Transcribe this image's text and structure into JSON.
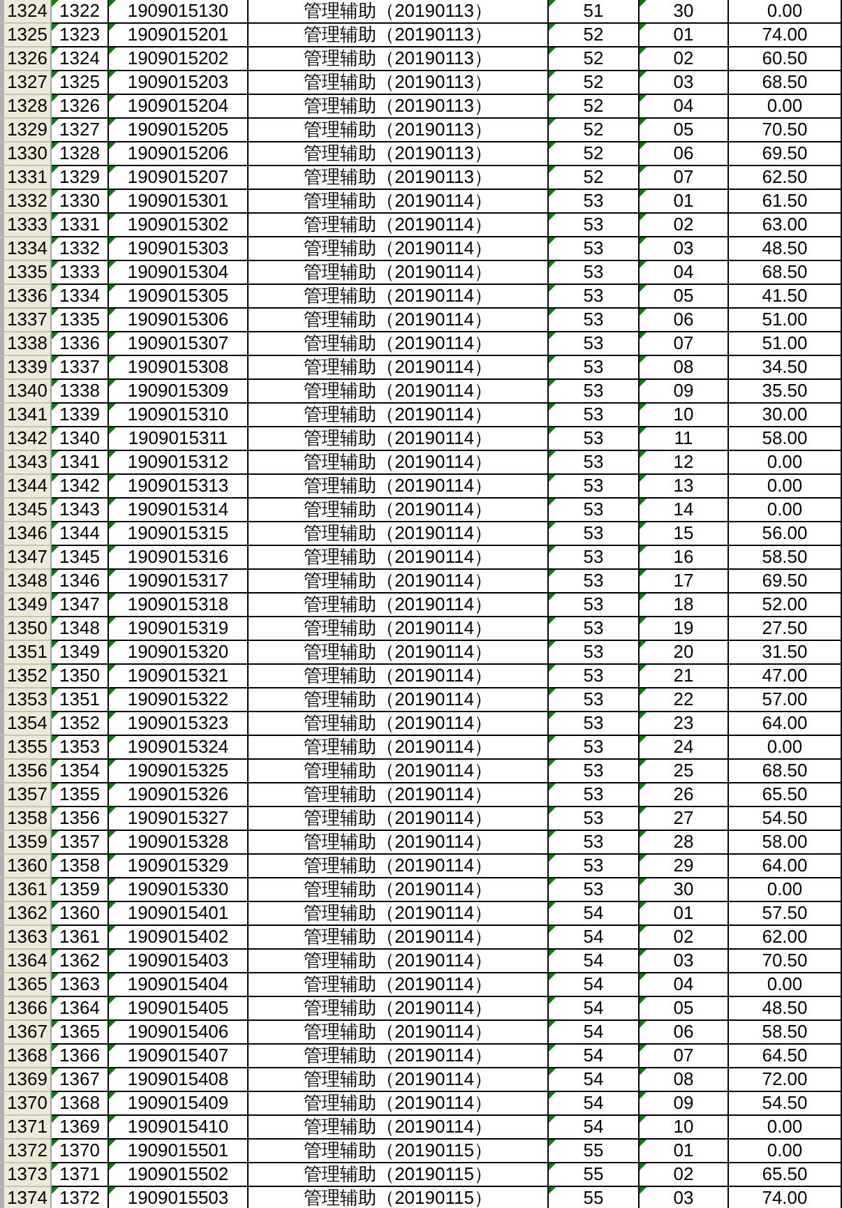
{
  "columns": [
    {
      "marker": true
    },
    {
      "marker": true
    },
    {
      "marker": false
    },
    {
      "marker": true
    },
    {
      "marker": true
    },
    {
      "marker": false
    }
  ],
  "rows": [
    {
      "header": "1324",
      "cells": [
        "1322",
        "1909015130",
        "管理辅助（20190113）",
        "51",
        "30",
        "0.00"
      ]
    },
    {
      "header": "1325",
      "cells": [
        "1323",
        "1909015201",
        "管理辅助（20190113）",
        "52",
        "01",
        "74.00"
      ]
    },
    {
      "header": "1326",
      "cells": [
        "1324",
        "1909015202",
        "管理辅助（20190113）",
        "52",
        "02",
        "60.50"
      ]
    },
    {
      "header": "1327",
      "cells": [
        "1325",
        "1909015203",
        "管理辅助（20190113）",
        "52",
        "03",
        "68.50"
      ]
    },
    {
      "header": "1328",
      "cells": [
        "1326",
        "1909015204",
        "管理辅助（20190113）",
        "52",
        "04",
        "0.00"
      ]
    },
    {
      "header": "1329",
      "cells": [
        "1327",
        "1909015205",
        "管理辅助（20190113）",
        "52",
        "05",
        "70.50"
      ]
    },
    {
      "header": "1330",
      "cells": [
        "1328",
        "1909015206",
        "管理辅助（20190113）",
        "52",
        "06",
        "69.50"
      ]
    },
    {
      "header": "1331",
      "cells": [
        "1329",
        "1909015207",
        "管理辅助（20190113）",
        "52",
        "07",
        "62.50"
      ]
    },
    {
      "header": "1332",
      "cells": [
        "1330",
        "1909015301",
        "管理辅助（20190114）",
        "53",
        "01",
        "61.50"
      ]
    },
    {
      "header": "1333",
      "cells": [
        "1331",
        "1909015302",
        "管理辅助（20190114）",
        "53",
        "02",
        "63.00"
      ]
    },
    {
      "header": "1334",
      "cells": [
        "1332",
        "1909015303",
        "管理辅助（20190114）",
        "53",
        "03",
        "48.50"
      ]
    },
    {
      "header": "1335",
      "cells": [
        "1333",
        "1909015304",
        "管理辅助（20190114）",
        "53",
        "04",
        "68.50"
      ]
    },
    {
      "header": "1336",
      "cells": [
        "1334",
        "1909015305",
        "管理辅助（20190114）",
        "53",
        "05",
        "41.50"
      ]
    },
    {
      "header": "1337",
      "cells": [
        "1335",
        "1909015306",
        "管理辅助（20190114）",
        "53",
        "06",
        "51.00"
      ]
    },
    {
      "header": "1338",
      "cells": [
        "1336",
        "1909015307",
        "管理辅助（20190114）",
        "53",
        "07",
        "51.00"
      ]
    },
    {
      "header": "1339",
      "cells": [
        "1337",
        "1909015308",
        "管理辅助（20190114）",
        "53",
        "08",
        "34.50"
      ]
    },
    {
      "header": "1340",
      "cells": [
        "1338",
        "1909015309",
        "管理辅助（20190114）",
        "53",
        "09",
        "35.50"
      ]
    },
    {
      "header": "1341",
      "cells": [
        "1339",
        "1909015310",
        "管理辅助（20190114）",
        "53",
        "10",
        "30.00"
      ]
    },
    {
      "header": "1342",
      "cells": [
        "1340",
        "1909015311",
        "管理辅助（20190114）",
        "53",
        "11",
        "58.00"
      ]
    },
    {
      "header": "1343",
      "cells": [
        "1341",
        "1909015312",
        "管理辅助（20190114）",
        "53",
        "12",
        "0.00"
      ]
    },
    {
      "header": "1344",
      "cells": [
        "1342",
        "1909015313",
        "管理辅助（20190114）",
        "53",
        "13",
        "0.00"
      ]
    },
    {
      "header": "1345",
      "cells": [
        "1343",
        "1909015314",
        "管理辅助（20190114）",
        "53",
        "14",
        "0.00"
      ]
    },
    {
      "header": "1346",
      "cells": [
        "1344",
        "1909015315",
        "管理辅助（20190114）",
        "53",
        "15",
        "56.00"
      ]
    },
    {
      "header": "1347",
      "cells": [
        "1345",
        "1909015316",
        "管理辅助（20190114）",
        "53",
        "16",
        "58.50"
      ]
    },
    {
      "header": "1348",
      "cells": [
        "1346",
        "1909015317",
        "管理辅助（20190114）",
        "53",
        "17",
        "69.50"
      ]
    },
    {
      "header": "1349",
      "cells": [
        "1347",
        "1909015318",
        "管理辅助（20190114）",
        "53",
        "18",
        "52.00"
      ]
    },
    {
      "header": "1350",
      "cells": [
        "1348",
        "1909015319",
        "管理辅助（20190114）",
        "53",
        "19",
        "27.50"
      ]
    },
    {
      "header": "1351",
      "cells": [
        "1349",
        "1909015320",
        "管理辅助（20190114）",
        "53",
        "20",
        "31.50"
      ]
    },
    {
      "header": "1352",
      "cells": [
        "1350",
        "1909015321",
        "管理辅助（20190114）",
        "53",
        "21",
        "47.00"
      ]
    },
    {
      "header": "1353",
      "cells": [
        "1351",
        "1909015322",
        "管理辅助（20190114）",
        "53",
        "22",
        "57.00"
      ]
    },
    {
      "header": "1354",
      "cells": [
        "1352",
        "1909015323",
        "管理辅助（20190114）",
        "53",
        "23",
        "64.00"
      ]
    },
    {
      "header": "1355",
      "cells": [
        "1353",
        "1909015324",
        "管理辅助（20190114）",
        "53",
        "24",
        "0.00"
      ]
    },
    {
      "header": "1356",
      "cells": [
        "1354",
        "1909015325",
        "管理辅助（20190114）",
        "53",
        "25",
        "68.50"
      ]
    },
    {
      "header": "1357",
      "cells": [
        "1355",
        "1909015326",
        "管理辅助（20190114）",
        "53",
        "26",
        "65.50"
      ]
    },
    {
      "header": "1358",
      "cells": [
        "1356",
        "1909015327",
        "管理辅助（20190114）",
        "53",
        "27",
        "54.50"
      ]
    },
    {
      "header": "1359",
      "cells": [
        "1357",
        "1909015328",
        "管理辅助（20190114）",
        "53",
        "28",
        "58.00"
      ]
    },
    {
      "header": "1360",
      "cells": [
        "1358",
        "1909015329",
        "管理辅助（20190114）",
        "53",
        "29",
        "64.00"
      ]
    },
    {
      "header": "1361",
      "cells": [
        "1359",
        "1909015330",
        "管理辅助（20190114）",
        "53",
        "30",
        "0.00"
      ]
    },
    {
      "header": "1362",
      "cells": [
        "1360",
        "1909015401",
        "管理辅助（20190114）",
        "54",
        "01",
        "57.50"
      ]
    },
    {
      "header": "1363",
      "cells": [
        "1361",
        "1909015402",
        "管理辅助（20190114）",
        "54",
        "02",
        "62.00"
      ]
    },
    {
      "header": "1364",
      "cells": [
        "1362",
        "1909015403",
        "管理辅助（20190114）",
        "54",
        "03",
        "70.50"
      ]
    },
    {
      "header": "1365",
      "cells": [
        "1363",
        "1909015404",
        "管理辅助（20190114）",
        "54",
        "04",
        "0.00"
      ]
    },
    {
      "header": "1366",
      "cells": [
        "1364",
        "1909015405",
        "管理辅助（20190114）",
        "54",
        "05",
        "48.50"
      ]
    },
    {
      "header": "1367",
      "cells": [
        "1365",
        "1909015406",
        "管理辅助（20190114）",
        "54",
        "06",
        "58.50"
      ]
    },
    {
      "header": "1368",
      "cells": [
        "1366",
        "1909015407",
        "管理辅助（20190114）",
        "54",
        "07",
        "64.50"
      ]
    },
    {
      "header": "1369",
      "cells": [
        "1367",
        "1909015408",
        "管理辅助（20190114）",
        "54",
        "08",
        "72.00"
      ]
    },
    {
      "header": "1370",
      "cells": [
        "1368",
        "1909015409",
        "管理辅助（20190114）",
        "54",
        "09",
        "54.50"
      ]
    },
    {
      "header": "1371",
      "cells": [
        "1369",
        "1909015410",
        "管理辅助（20190114）",
        "54",
        "10",
        "0.00"
      ]
    },
    {
      "header": "1372",
      "cells": [
        "1370",
        "1909015501",
        "管理辅助（20190115）",
        "55",
        "01",
        "0.00"
      ]
    },
    {
      "header": "1373",
      "cells": [
        "1371",
        "1909015502",
        "管理辅助（20190115）",
        "55",
        "02",
        "65.50"
      ]
    },
    {
      "header": "1374",
      "cells": [
        "1372",
        "1909015503",
        "管理辅助（20190115）",
        "55",
        "03",
        "74.00"
      ]
    }
  ]
}
